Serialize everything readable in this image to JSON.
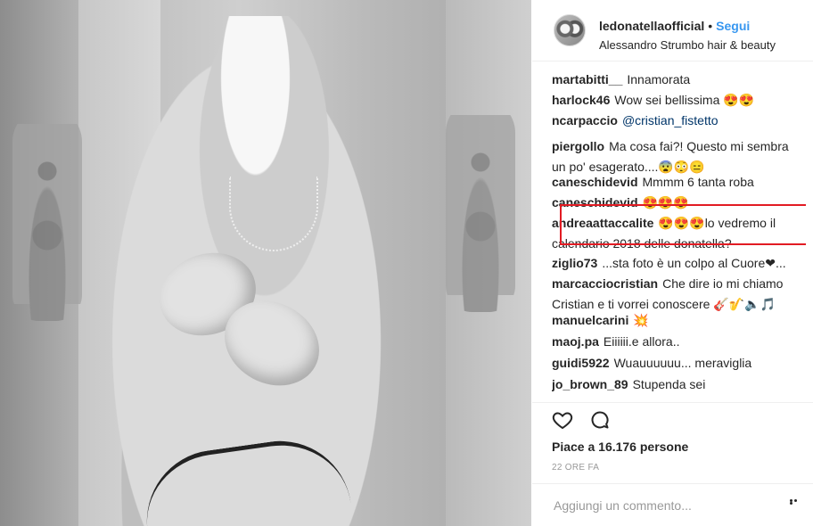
{
  "post": {
    "username": "ledonatellaofficial",
    "separator": "•",
    "follow_label": "Segui",
    "location": "Alessandro Strumbo hair & beauty",
    "likes_text": "Piace a 16.176 persone",
    "time_ago": "22 ORE FA",
    "comment_placeholder": "Aggiungi un commento..."
  },
  "comments": [
    {
      "user": "martabitti__",
      "text": "Innamorata"
    },
    {
      "user": "harlock46",
      "text": "Wow sei bellissima 😍😍"
    },
    {
      "user": "ncarpaccio",
      "text": "@cristian_fistetto"
    },
    {
      "user": "piergollo",
      "text": "Ma cosa fai?! Questo mi sembra",
      "text2": "un po' esagerato....😨😳😑"
    },
    {
      "user": "caneschidevid",
      "text": "Mmmm 6 tanta roba"
    },
    {
      "user": "caneschidevid",
      "text": "😍😍😍"
    },
    {
      "user": "andreaattaccalite",
      "text": "😍😍😍lo vedremo il",
      "text2": "calendario 2018 delle donatella?"
    },
    {
      "user": "ziglio73",
      "text": "...sta foto è un colpo al Cuore❤..."
    },
    {
      "user": "marcacciocristian",
      "text": "Che dire io mi chiamo",
      "text2": "Cristian e ti vorrei conoscere 🎸🎷🔈🎵"
    },
    {
      "user": "manuelcarini",
      "text": "💥"
    },
    {
      "user": "maoj.pa",
      "text": "Eiiiiii.e allora.."
    },
    {
      "user": "guidi5922",
      "text": "Wuauuuuuu... meraviglia"
    },
    {
      "user": "jo_brown_89",
      "text": "Stupenda sei"
    }
  ],
  "icons": {
    "heart": "heart-icon",
    "comment": "comment-icon",
    "more": "more-options-icon"
  },
  "colors": {
    "follow": "#3897f0",
    "highlight": "#e21b23",
    "text": "#262626",
    "muted": "#999999"
  }
}
